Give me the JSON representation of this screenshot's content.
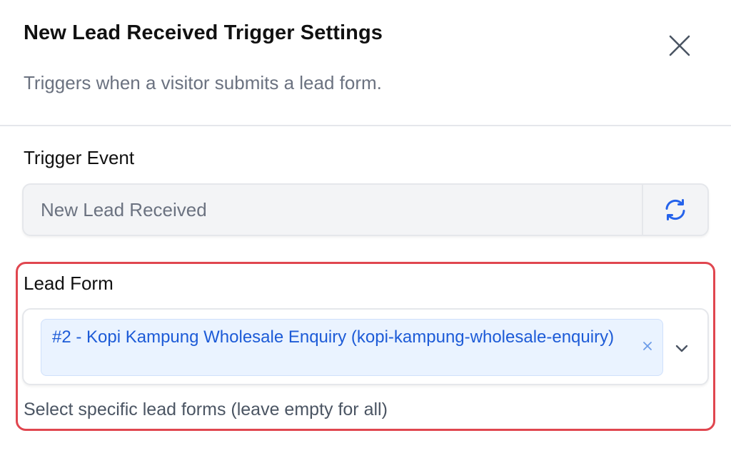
{
  "dialog": {
    "title": "New Lead Received Trigger Settings",
    "subtitle": "Triggers when a visitor submits a lead form.",
    "close_icon": "close-icon"
  },
  "trigger_event": {
    "label": "Trigger Event",
    "value": "New Lead Received",
    "refresh_icon": "refresh-icon"
  },
  "lead_form": {
    "label": "Lead Form",
    "selected": [
      {
        "text": "#2 - Kopi Kampung Wholesale Enquiry (kopi-kampung-wholesale-enquiry)"
      }
    ],
    "remove_icon": "x-icon",
    "dropdown_icon": "chevron-down-icon",
    "help_text": "Select specific lead forms (leave empty for all)"
  },
  "colors": {
    "highlight_border": "#e0464f",
    "chip_background": "#eaf3ff",
    "chip_text": "#1d5bd7",
    "refresh_icon": "#2563eb"
  }
}
